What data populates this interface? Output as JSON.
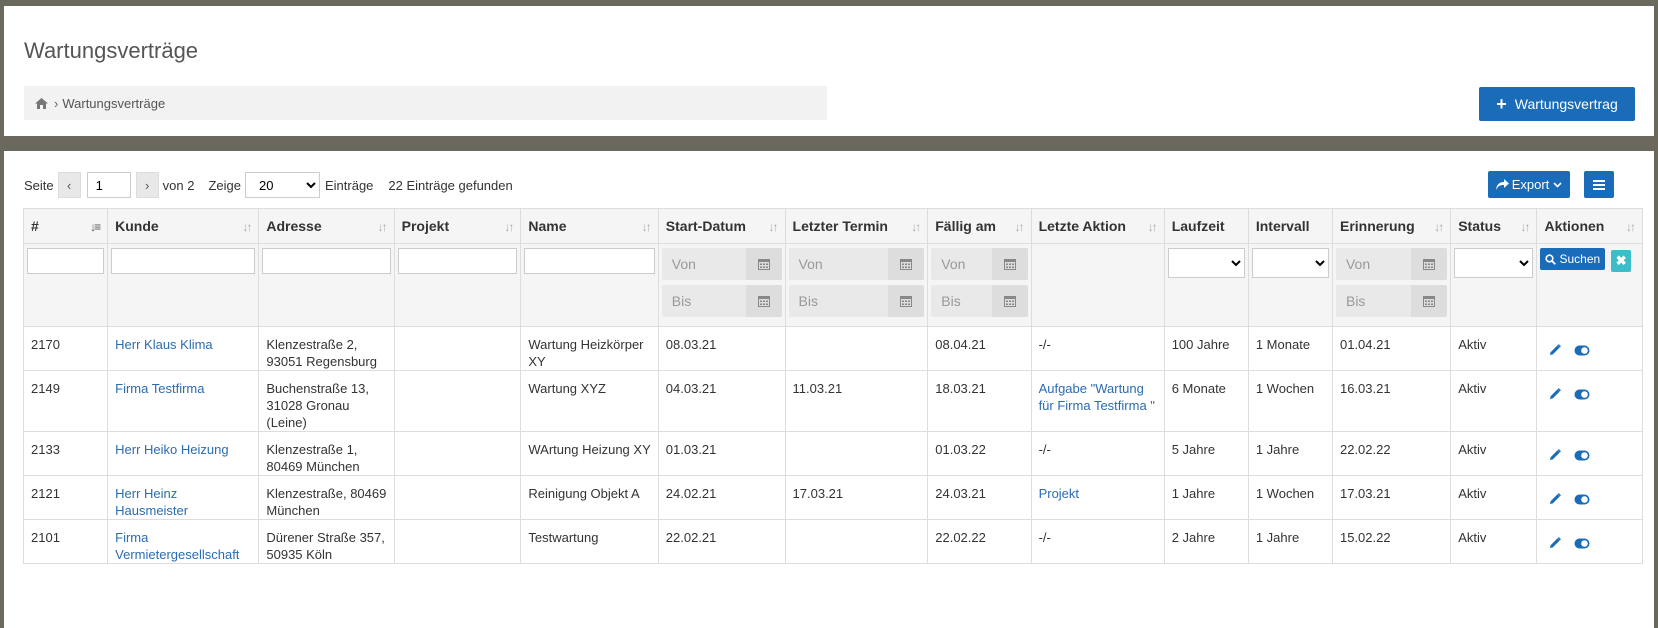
{
  "header": {
    "title": "Wartungsverträge",
    "breadcrumb": "Wartungsverträge",
    "add_button": "Wartungsvertrag"
  },
  "toolbar": {
    "page_label": "Seite",
    "current_page": "1",
    "of_pages": "von 2",
    "show_label": "Zeige",
    "page_size": "20",
    "entries_label": "Einträge",
    "found": "22 Einträge gefunden",
    "export_label": "Export"
  },
  "filters": {
    "from_placeholder": "Von",
    "to_placeholder": "Bis",
    "search_label": "Suchen"
  },
  "columns": [
    "#",
    "Kunde",
    "Adresse",
    "Projekt",
    "Name",
    "Start-Datum",
    "Letzter Termin",
    "Fällig am",
    "Letzte Aktion",
    "Laufzeit",
    "Intervall",
    "Erinnerung",
    "Status",
    "Aktionen"
  ],
  "rows": [
    {
      "id": "2170",
      "kunde": "Herr Klaus Klima",
      "adresse": "Klenzestraße 2, 93051 Regensburg",
      "projekt": "",
      "name": "Wartung Heizkörper XY",
      "start": "08.03.21",
      "letzter": "",
      "faellig": "08.04.21",
      "aktion": "-/-",
      "laufzeit": "100 Jahre",
      "intervall": "1 Monate",
      "erinnerung": "01.04.21",
      "status": "Aktiv"
    },
    {
      "id": "2149",
      "kunde": "Firma Testfirma",
      "adresse": "Buchenstraße 13, 31028 Gronau (Leine)",
      "projekt": "",
      "name": "Wartung XYZ",
      "start": "04.03.21",
      "letzter": "11.03.21",
      "faellig": "18.03.21",
      "aktion": "Aufgabe \"Wartung für Firma Testfirma \"",
      "laufzeit": "6 Monate",
      "intervall": "1 Wochen",
      "erinnerung": "16.03.21",
      "status": "Aktiv"
    },
    {
      "id": "2133",
      "kunde": "Herr Heiko Heizung",
      "adresse": "Klenzestraße 1, 80469 München",
      "projekt": "",
      "name": "WArtung Heizung XY",
      "start": "01.03.21",
      "letzter": "",
      "faellig": "01.03.22",
      "aktion": "-/-",
      "laufzeit": "5 Jahre",
      "intervall": "1 Jahre",
      "erinnerung": "22.02.22",
      "status": "Aktiv"
    },
    {
      "id": "2121",
      "kunde": "Herr Heinz Hausmeister",
      "adresse": "Klenzestraße, 80469 München",
      "projekt": "",
      "name": "Reinigung Objekt A",
      "start": "24.02.21",
      "letzter": "17.03.21",
      "faellig": "24.03.21",
      "aktion": "Projekt",
      "laufzeit": "1 Jahre",
      "intervall": "1 Wochen",
      "erinnerung": "17.03.21",
      "status": "Aktiv"
    },
    {
      "id": "2101",
      "kunde": "Firma Vermietergesellschaft",
      "adresse": "Dürener Straße 357, 50935 Köln",
      "projekt": "",
      "name": "Testwartung",
      "start": "22.02.21",
      "letzter": "",
      "faellig": "22.02.22",
      "aktion": "-/-",
      "laufzeit": "2 Jahre",
      "intervall": "1 Jahre",
      "erinnerung": "15.02.22",
      "status": "Aktiv"
    }
  ],
  "colors": {
    "primary": "#1a6bb8",
    "link": "#2b6cb0",
    "teal": "#3cbdc9",
    "frame": "#6b685e"
  }
}
